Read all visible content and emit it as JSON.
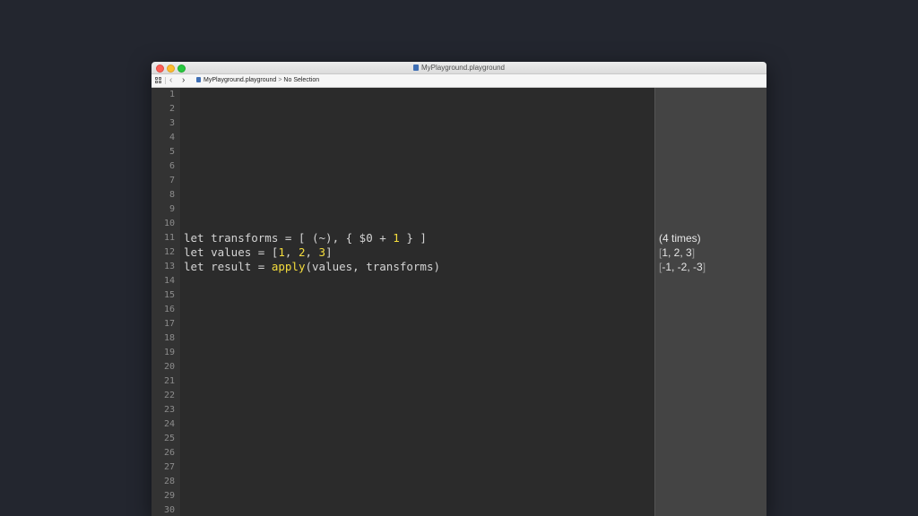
{
  "window": {
    "title": "MyPlayground.playground"
  },
  "toolbar": {
    "back_icon": "chevron-left-icon",
    "forward_icon": "chevron-right-icon",
    "breadcrumb": {
      "file": "MyPlayground.playground",
      "separator": ">",
      "selection": "No Selection"
    }
  },
  "editor": {
    "line_numbers": [
      "1",
      "2",
      "3",
      "4",
      "5",
      "6",
      "7",
      "8",
      "9",
      "10",
      "11",
      "12",
      "13",
      "14",
      "15",
      "16",
      "17",
      "18",
      "19",
      "20",
      "21",
      "22",
      "23",
      "24",
      "25",
      "26",
      "27",
      "28",
      "29",
      "30"
    ],
    "code": {
      "line11": [
        "let transforms = [ (~), { $0 + ",
        "1",
        " } ]"
      ],
      "line12": [
        "let values = [",
        "1",
        ", ",
        "2",
        ", ",
        "3",
        "]"
      ],
      "line13": [
        "let result = ",
        "apply",
        "(values, transforms)"
      ]
    }
  },
  "results": {
    "line11": "(4 times)",
    "line12": [
      "[",
      "1, 2, 3",
      "]"
    ],
    "line13": [
      "[",
      "-1, -2, -3",
      "]"
    ]
  },
  "colors": {
    "background": "#23262f",
    "editor_bg": "#2b2b2b",
    "results_bg": "#444444",
    "keyword_text": "#d4d4d4",
    "literal_highlight": "#f5dd3c"
  }
}
